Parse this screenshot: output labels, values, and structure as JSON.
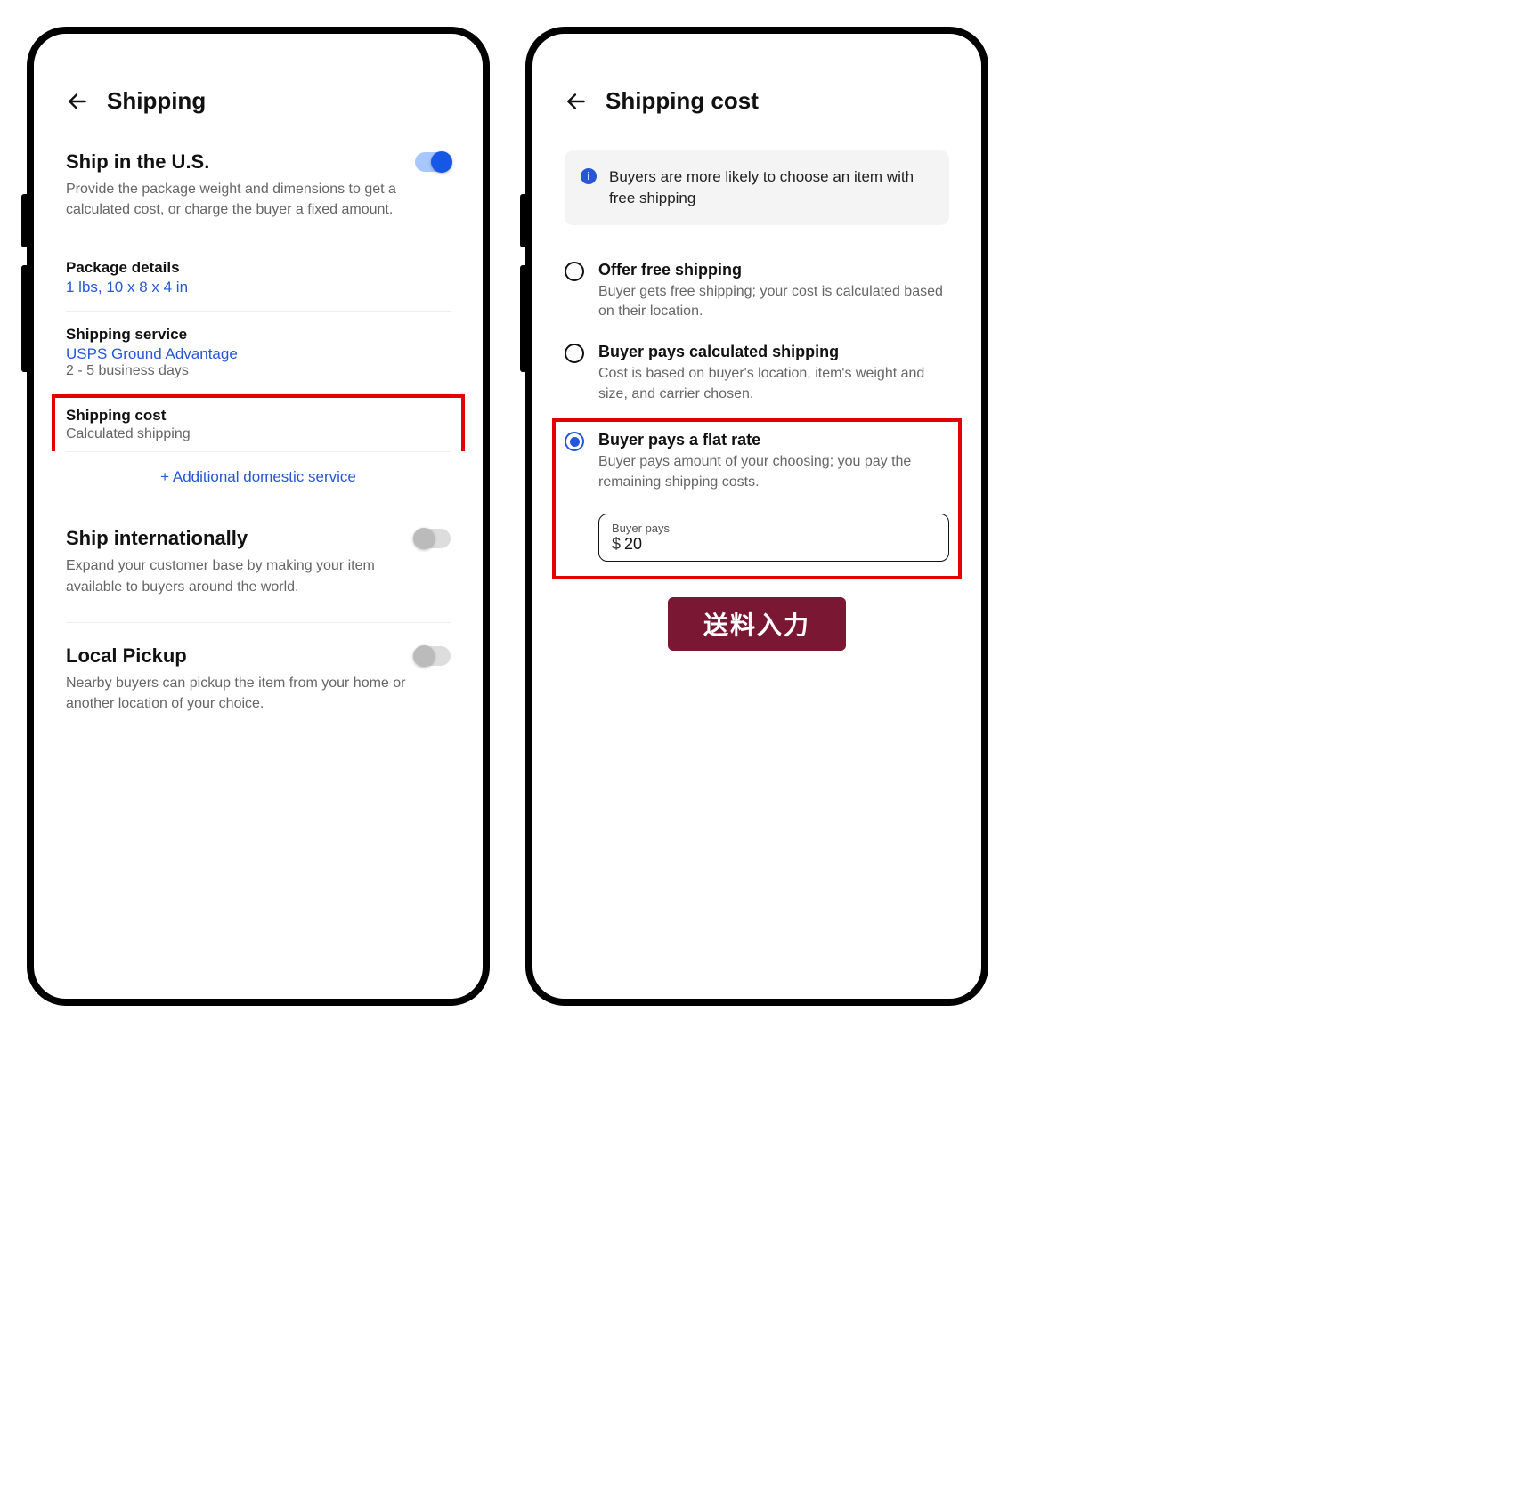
{
  "left": {
    "title": "Shipping",
    "ship_us": {
      "title": "Ship in the U.S.",
      "desc": "Provide the package weight and dimensions to get a calculated cost, or charge the buyer a fixed amount.",
      "toggle": true
    },
    "package": {
      "label": "Package details",
      "value": "1 lbs, 10 x 8 x 4 in"
    },
    "service": {
      "label": "Shipping service",
      "value": "USPS Ground Advantage",
      "sub": "2 - 5 business days"
    },
    "cost": {
      "label": "Shipping cost",
      "value": "Calculated shipping"
    },
    "add_link": "+ Additional domestic service",
    "intl": {
      "title": "Ship internationally",
      "desc": "Expand your customer base by making your item available to buyers around the world.",
      "toggle": false
    },
    "pickup": {
      "title": "Local Pickup",
      "desc": "Nearby buyers can pickup the item from your home or another location of your choice.",
      "toggle": false
    }
  },
  "right": {
    "title": "Shipping cost",
    "info": "Buyers are more likely to choose an item with free shipping",
    "options": {
      "free": {
        "label": "Offer free shipping",
        "desc": "Buyer gets free shipping; your cost is calculated based on their location."
      },
      "calc": {
        "label": "Buyer pays calculated shipping",
        "desc": "Cost is based on buyer's location, item's weight and size, and carrier chosen."
      },
      "flat": {
        "label": "Buyer pays a flat rate",
        "desc": "Buyer pays amount of your choosing; you pay the remaining shipping costs.",
        "input_label": "Buyer pays",
        "currency": "$",
        "value": "20"
      }
    },
    "callout": "送料入力"
  }
}
